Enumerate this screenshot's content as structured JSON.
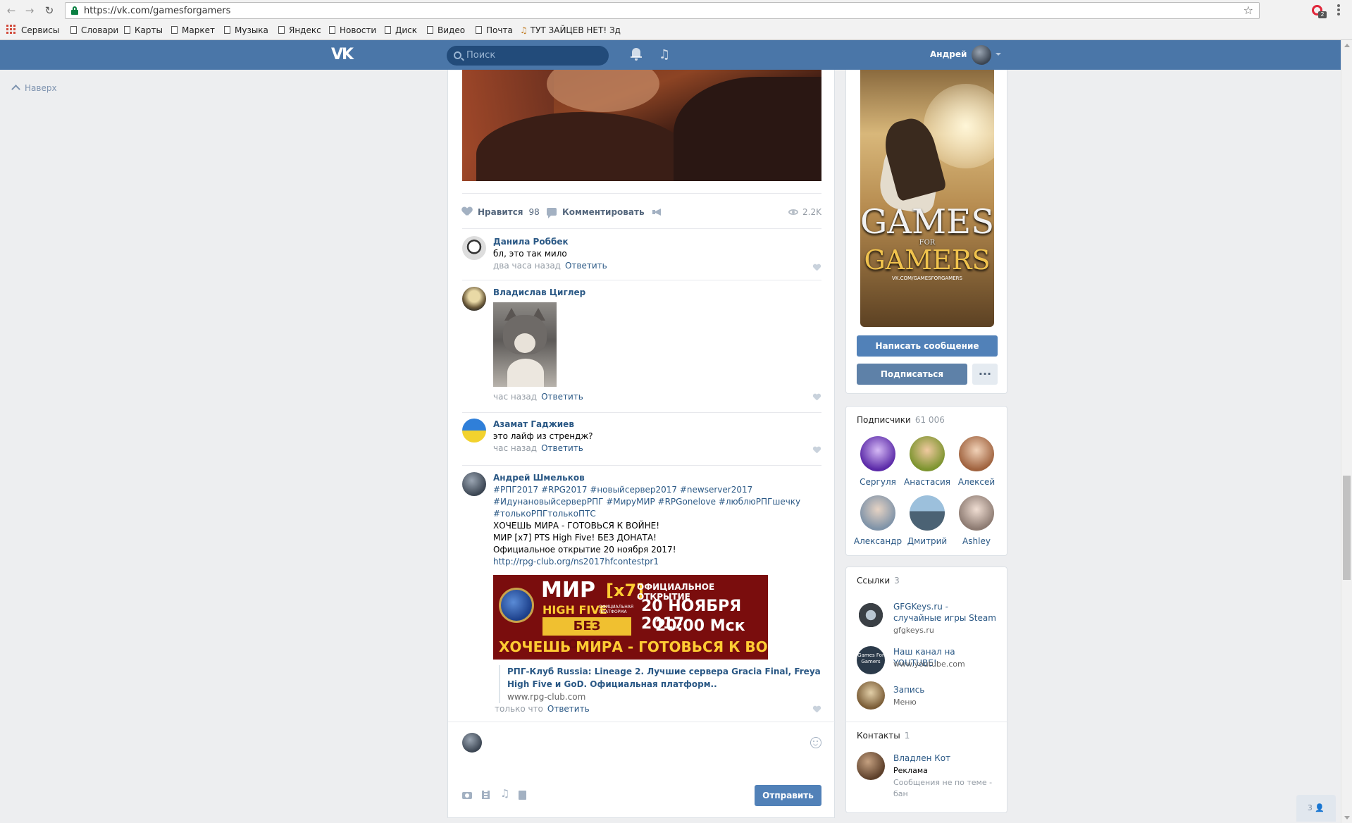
{
  "browser": {
    "url": "https://vk.com/gamesforgamers",
    "opera_badge": "2",
    "bookmarks": [
      "Сервисы",
      "Словари",
      "Карты",
      "Маркет",
      "Музыка",
      "Яндекс",
      "Новости",
      "Диск",
      "Видео",
      "Почта",
      "ТУТ ЗАЙЦЕВ НЕТ! Зд"
    ]
  },
  "header": {
    "logo": "VK",
    "search_placeholder": "Поиск",
    "user_name": "Андрей"
  },
  "left": {
    "to_top": "Наверх"
  },
  "post": {
    "like_label": "Нравится",
    "like_count": "98",
    "comment_label": "Комментировать",
    "views": "2.2K"
  },
  "comments": [
    {
      "author": "Данила Роббек",
      "text": "бл, это так мило",
      "time": "два часа назад",
      "reply": "Ответить"
    },
    {
      "author": "Владислав Циглер",
      "time": "час назад",
      "reply": "Ответить"
    },
    {
      "author": "Азамат Гаджиев",
      "text": "это лайф из стрендж?",
      "time": "час назад",
      "reply": "Ответить"
    },
    {
      "author": "Андрей Шмельков",
      "tags1": "#РПГ2017 #RPG2017 #новыйсервер2017 #newserver2017",
      "tags2": "#ИдунановыйсерверРПГ #МируМИР #RPGonelove #люблюРПГшечку",
      "tags3": "#толькоРПГтолькоПТС",
      "line1": "ХОЧЕШЬ МИРА - ГОТОВЬСЯ К ВОЙНЕ!",
      "line2": "МИР [x7] PTS High Five! БЕЗ ДОНАТА!",
      "line3": "Официальное открытие 20 ноября 2017!",
      "link": "http://rpg-club.org/ns2017hfcontestpr1",
      "banner": {
        "mir": "МИР",
        "x7": "[x7]",
        "high_five": "HIGH FIVE",
        "platform": "ОФИЦИАЛЬНАЯ ПЛАТФОРМА",
        "no_donate": "БЕЗ ДОНАТА",
        "opening": "ОФИЦИАЛЬНОЕ ОТКРЫТИЕ",
        "date": "20 НОЯБРЯ 2017",
        "time": "20:00 Мск",
        "slogan": "ХОЧЕШЬ МИРА - ГОТОВЬСЯ К ВОЙНЕ"
      },
      "preview_title": "РПГ-Клуб Russia: Lineage 2. Лучшие сервера Gracia Final, Freya High Five и GoD. Официальная платформ..",
      "preview_domain": "www.rpg-club.com",
      "time": "только что",
      "reply": "Ответить"
    }
  ],
  "composer": {
    "send": "Отправить"
  },
  "group": {
    "cover_title1": "GAMES",
    "cover_title2": "FOR",
    "cover_title3": "GAMERS",
    "cover_url": "VK.COM/GAMESFORGAMERS",
    "message_button": "Написать сообщение",
    "subscribe_button": "Подписаться",
    "more_button": "···"
  },
  "subscribers": {
    "title": "Подписчики",
    "count": "61 006",
    "people": [
      {
        "name": "Сергуля",
        "color": "#7a4bc4"
      },
      {
        "name": "Анастасия",
        "color": "#8ca33e"
      },
      {
        "name": "Алексей",
        "color": "#c98a5d"
      },
      {
        "name": "Александр",
        "color": "#8ea1b5"
      },
      {
        "name": "Дмитрий",
        "color": "#6a89a3"
      },
      {
        "name": "Ashley",
        "color": "#a8968c"
      }
    ]
  },
  "links": {
    "title": "Ссылки",
    "count": "3",
    "items": [
      {
        "title": "GFGKeys.ru - случайные игры Steam",
        "sub": "gfgkeys.ru"
      },
      {
        "title": "Наш канал на YOUTUBE!",
        "sub": "www.youtube.com",
        "icon_text": "Games For Gamers"
      },
      {
        "title": "Запись",
        "sub": "Меню"
      }
    ]
  },
  "contacts": {
    "title": "Контакты",
    "count": "1",
    "person": {
      "name": "Владлен Кот",
      "role": "Реклама",
      "note": "Сообщения не по теме - бан"
    }
  },
  "online_badge": "3"
}
